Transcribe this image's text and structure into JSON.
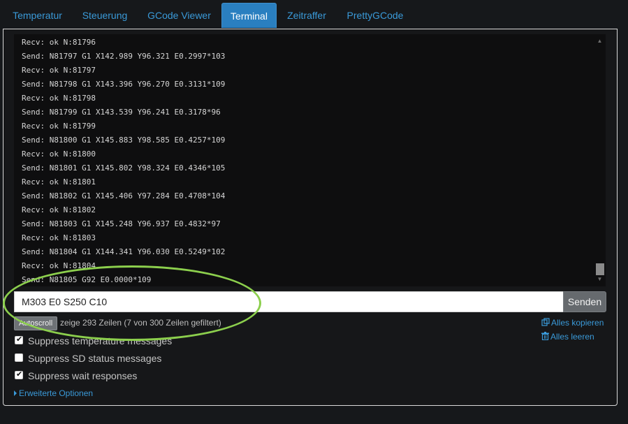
{
  "tabs": [
    {
      "label": "Temperatur"
    },
    {
      "label": "Steuerung"
    },
    {
      "label": "GCode Viewer"
    },
    {
      "label": "Terminal"
    },
    {
      "label": "Zeitraffer"
    },
    {
      "label": "PrettyGCode"
    }
  ],
  "active_tab": "Terminal",
  "terminal": {
    "lines": [
      "Recv: ok N:81796",
      "Send: N81797 G1 X142.989 Y96.321 E0.2997*103",
      "Recv: ok N:81797",
      "Send: N81798 G1 X143.396 Y96.270 E0.3131*109",
      "Recv: ok N:81798",
      "Send: N81799 G1 X143.539 Y96.241 E0.3178*96",
      "Recv: ok N:81799",
      "Send: N81800 G1 X145.883 Y98.585 E0.4257*109",
      "Recv: ok N:81800",
      "Send: N81801 G1 X145.802 Y98.324 E0.4346*105",
      "Recv: ok N:81801",
      "Send: N81802 G1 X145.406 Y97.284 E0.4708*104",
      "Recv: ok N:81802",
      "Send: N81803 G1 X145.248 Y96.937 E0.4832*97",
      "Recv: ok N:81803",
      "Send: N81804 G1 X144.341 Y96.030 E0.5249*102",
      "Recv: ok N:81804",
      "Send: N81805 G92 E0.0000*109"
    ]
  },
  "command": {
    "value": "M303 E0 S250 C10",
    "send_label": "Senden"
  },
  "autoscroll_label": "Autoscroll",
  "status": "zeige 293 Zeilen (7 von 300 Zeilen gefiltert)",
  "links": {
    "copy_all": "Alles kopieren",
    "clear_all": "Alles leeren"
  },
  "options": [
    {
      "label": "Suppress temperature messages",
      "checked": true
    },
    {
      "label": "Suppress SD status messages",
      "checked": false
    },
    {
      "label": "Suppress wait responses",
      "checked": true
    }
  ],
  "advanced_label": "Erweiterte Optionen",
  "colors": {
    "accent": "#3a9ad9",
    "active_tab": "#2a7fc0",
    "highlight": "#8ccf4d"
  }
}
